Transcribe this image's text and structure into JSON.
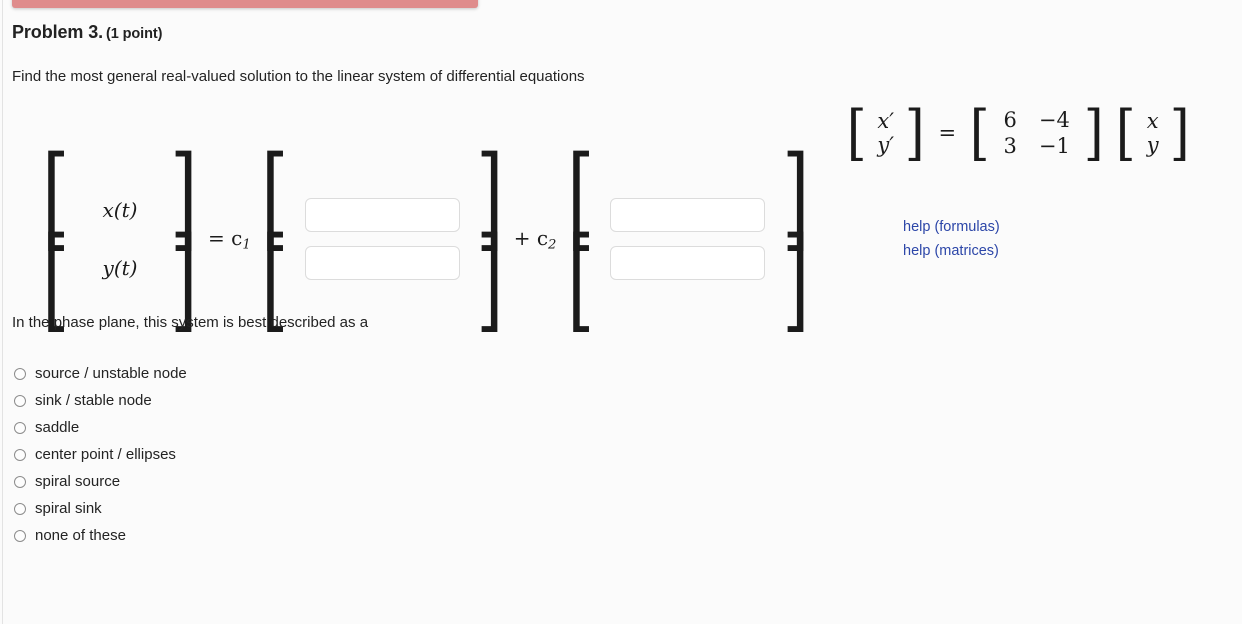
{
  "banner": {
    "color": "#df8c8c"
  },
  "problem": {
    "title": "Problem 3.",
    "points": "(1 point)",
    "prompt": "Find the most general real-valued solution to the linear system of differential equations"
  },
  "system_equation": {
    "lhs": [
      "x′",
      "y′"
    ],
    "equals": "=",
    "matrix": [
      [
        "6",
        "−4"
      ],
      [
        "3",
        "−1"
      ]
    ],
    "rhs": [
      "x",
      "y"
    ]
  },
  "answer": {
    "lhs_vector": [
      "x(t)",
      "y(t)"
    ],
    "equals_c1": "= c",
    "c1_sub": "1",
    "plus_c2": "+ c",
    "c2_sub": "2",
    "fields": [
      {
        "name": "c1-row1",
        "value": "",
        "placeholder": ""
      },
      {
        "name": "c1-row2",
        "value": "",
        "placeholder": ""
      },
      {
        "name": "c2-row1",
        "value": "",
        "placeholder": ""
      },
      {
        "name": "c2-row2",
        "value": "",
        "placeholder": ""
      }
    ]
  },
  "help": {
    "formulas": "help (formulas)",
    "matrices": "help (matrices)",
    "link_color": "#2c46a8"
  },
  "phase_question": {
    "text": "In the phase plane, this system is best described as a",
    "options": [
      "source / unstable node",
      "sink / stable node",
      "saddle",
      "center point / ellipses",
      "spiral source",
      "spiral sink",
      "none of these"
    ],
    "selected": null
  }
}
